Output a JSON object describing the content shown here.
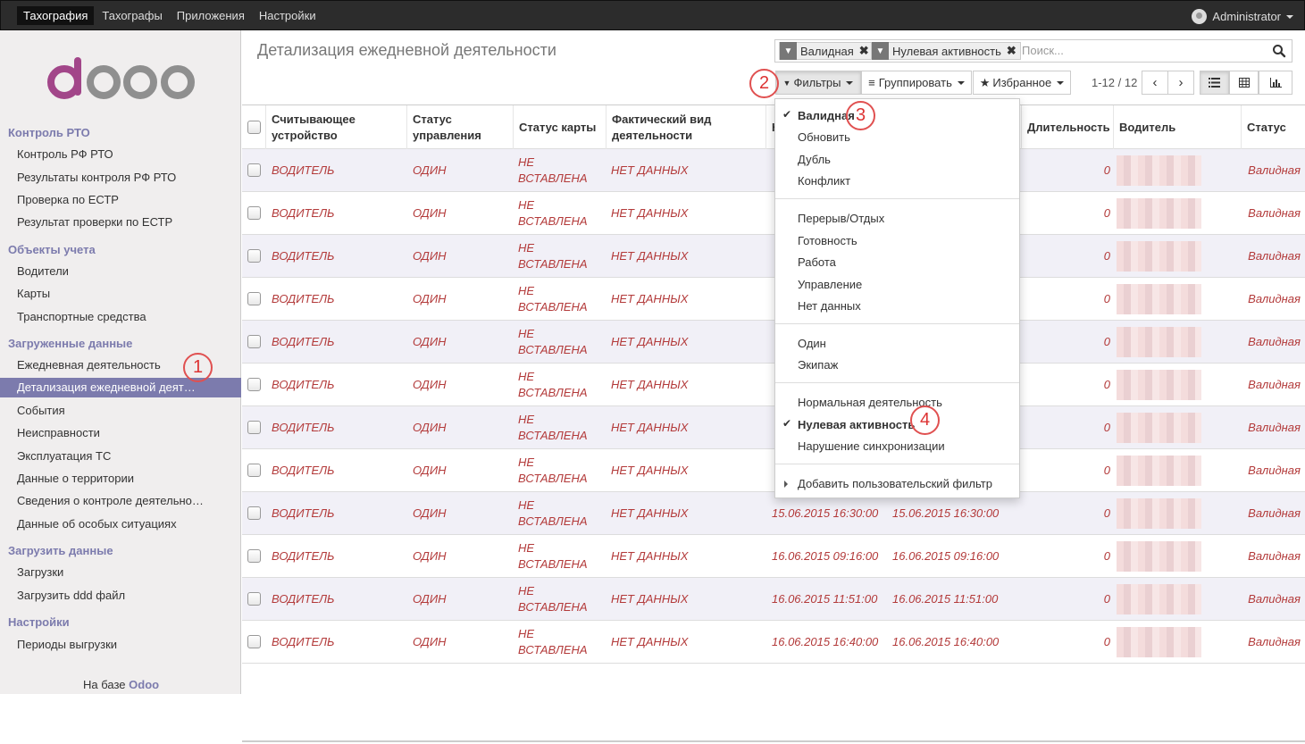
{
  "topbar": {
    "menu": [
      "Тахография",
      "Тахографы",
      "Приложения",
      "Настройки"
    ],
    "user": "Administrator"
  },
  "sidebar": {
    "sections": [
      {
        "title": "Контроль РТО",
        "items": [
          "Контроль РФ РТО",
          "Результаты контроля РФ РТО",
          "Проверка по ЕСТР",
          "Результат проверки по ЕСТР"
        ]
      },
      {
        "title": "Объекты учета",
        "items": [
          "Водители",
          "Карты",
          "Транспортные средства"
        ]
      },
      {
        "title": "Загруженные данные",
        "items": [
          "Ежедневная деятельность",
          "Детализация ежедневной деят…",
          "События",
          "Неисправности",
          "Эксплуатация ТС",
          "Данные о территории",
          "Сведения о контроле деятельно…",
          "Данные об особых ситуациях"
        ]
      },
      {
        "title": "Загрузить данные",
        "items": [
          "Загрузки",
          "Загрузить ddd файл"
        ]
      },
      {
        "title": "Настройки",
        "items": [
          "Периоды выгрузки"
        ]
      }
    ],
    "powered_prefix": "На базе",
    "powered_brand": "Odoo"
  },
  "page": {
    "title": "Детализация ежедневной деятельности",
    "facets": [
      "Валидная",
      "Нулевая активность"
    ],
    "search_placeholder": "Поиск...",
    "filters_label": "Фильтры",
    "group_label": "Группировать",
    "favorites_label": "Избранное",
    "pager": "1-12 / 12"
  },
  "table": {
    "columns": [
      "Считывающее устройство",
      "Статус управления",
      "Статус карты",
      "Фактический вид деятельности",
      "Н д",
      "",
      "Длительность",
      "Водитель",
      "Статус"
    ],
    "rows": [
      {
        "device": "ВОДИТЕЛЬ",
        "mode": "ОДИН",
        "card": "НЕ ВСТАВЛЕНА",
        "activity": "НЕТ ДАННЫХ",
        "start": "",
        "end": "",
        "duration": "0",
        "status": "Валидная"
      },
      {
        "device": "ВОДИТЕЛЬ",
        "mode": "ОДИН",
        "card": "НЕ ВСТАВЛЕНА",
        "activity": "НЕТ ДАННЫХ",
        "start": "",
        "end": "",
        "duration": "0",
        "status": "Валидная"
      },
      {
        "device": "ВОДИТЕЛЬ",
        "mode": "ОДИН",
        "card": "НЕ ВСТАВЛЕНА",
        "activity": "НЕТ ДАННЫХ",
        "start": "",
        "end": "",
        "duration": "0",
        "status": "Валидная"
      },
      {
        "device": "ВОДИТЕЛЬ",
        "mode": "ОДИН",
        "card": "НЕ ВСТАВЛЕНА",
        "activity": "НЕТ ДАННЫХ",
        "start": "",
        "end": "",
        "duration": "0",
        "status": "Валидная"
      },
      {
        "device": "ВОДИТЕЛЬ",
        "mode": "ОДИН",
        "card": "НЕ ВСТАВЛЕНА",
        "activity": "НЕТ ДАННЫХ",
        "start": "",
        "end": "",
        "duration": "0",
        "status": "Валидная"
      },
      {
        "device": "ВОДИТЕЛЬ",
        "mode": "ОДИН",
        "card": "НЕ ВСТАВЛЕНА",
        "activity": "НЕТ ДАННЫХ",
        "start": "",
        "end": "",
        "duration": "0",
        "status": "Валидная"
      },
      {
        "device": "ВОДИТЕЛЬ",
        "mode": "ОДИН",
        "card": "НЕ ВСТАВЛЕНА",
        "activity": "НЕТ ДАННЫХ",
        "start": "",
        "end": "",
        "duration": "0",
        "status": "Валидная"
      },
      {
        "device": "ВОДИТЕЛЬ",
        "mode": "ОДИН",
        "card": "НЕ ВСТАВЛЕНА",
        "activity": "НЕТ ДАННЫХ",
        "start": "",
        "end": "",
        "duration": "0",
        "status": "Валидная"
      },
      {
        "device": "ВОДИТЕЛЬ",
        "mode": "ОДИН",
        "card": "НЕ ВСТАВЛЕНА",
        "activity": "НЕТ ДАННЫХ",
        "start": "15.06.2015 16:30:00",
        "end": "15.06.2015 16:30:00",
        "duration": "0",
        "status": "Валидная"
      },
      {
        "device": "ВОДИТЕЛЬ",
        "mode": "ОДИН",
        "card": "НЕ ВСТАВЛЕНА",
        "activity": "НЕТ ДАННЫХ",
        "start": "16.06.2015 09:16:00",
        "end": "16.06.2015 09:16:00",
        "duration": "0",
        "status": "Валидная"
      },
      {
        "device": "ВОДИТЕЛЬ",
        "mode": "ОДИН",
        "card": "НЕ ВСТАВЛЕНА",
        "activity": "НЕТ ДАННЫХ",
        "start": "16.06.2015 11:51:00",
        "end": "16.06.2015 11:51:00",
        "duration": "0",
        "status": "Валидная"
      },
      {
        "device": "ВОДИТЕЛЬ",
        "mode": "ОДИН",
        "card": "НЕ ВСТАВЛЕНА",
        "activity": "НЕТ ДАННЫХ",
        "start": "16.06.2015 16:40:00",
        "end": "16.06.2015 16:40:00",
        "duration": "0",
        "status": "Валидная"
      }
    ]
  },
  "filters_dropdown": {
    "groups": [
      [
        {
          "label": "Валидная",
          "checked": true
        },
        {
          "label": "Обновить"
        },
        {
          "label": "Дубль"
        },
        {
          "label": "Конфликт"
        }
      ],
      [
        {
          "label": "Перерыв/Отдых"
        },
        {
          "label": "Готовность"
        },
        {
          "label": "Работа"
        },
        {
          "label": "Управление"
        },
        {
          "label": "Нет данных"
        }
      ],
      [
        {
          "label": "Один"
        },
        {
          "label": "Экипаж"
        }
      ],
      [
        {
          "label": "Нормальная деятельность"
        },
        {
          "label": "Нулевая активность",
          "checked": true
        },
        {
          "label": "Нарушение синхронизации"
        }
      ]
    ],
    "custom_filter": "Добавить пользовательский фильтр"
  },
  "annotations": [
    "1",
    "2",
    "3",
    "4"
  ],
  "colors": {
    "brand": "#7c7bad",
    "row_text": "#b33a3a",
    "badge": "#e05050"
  }
}
